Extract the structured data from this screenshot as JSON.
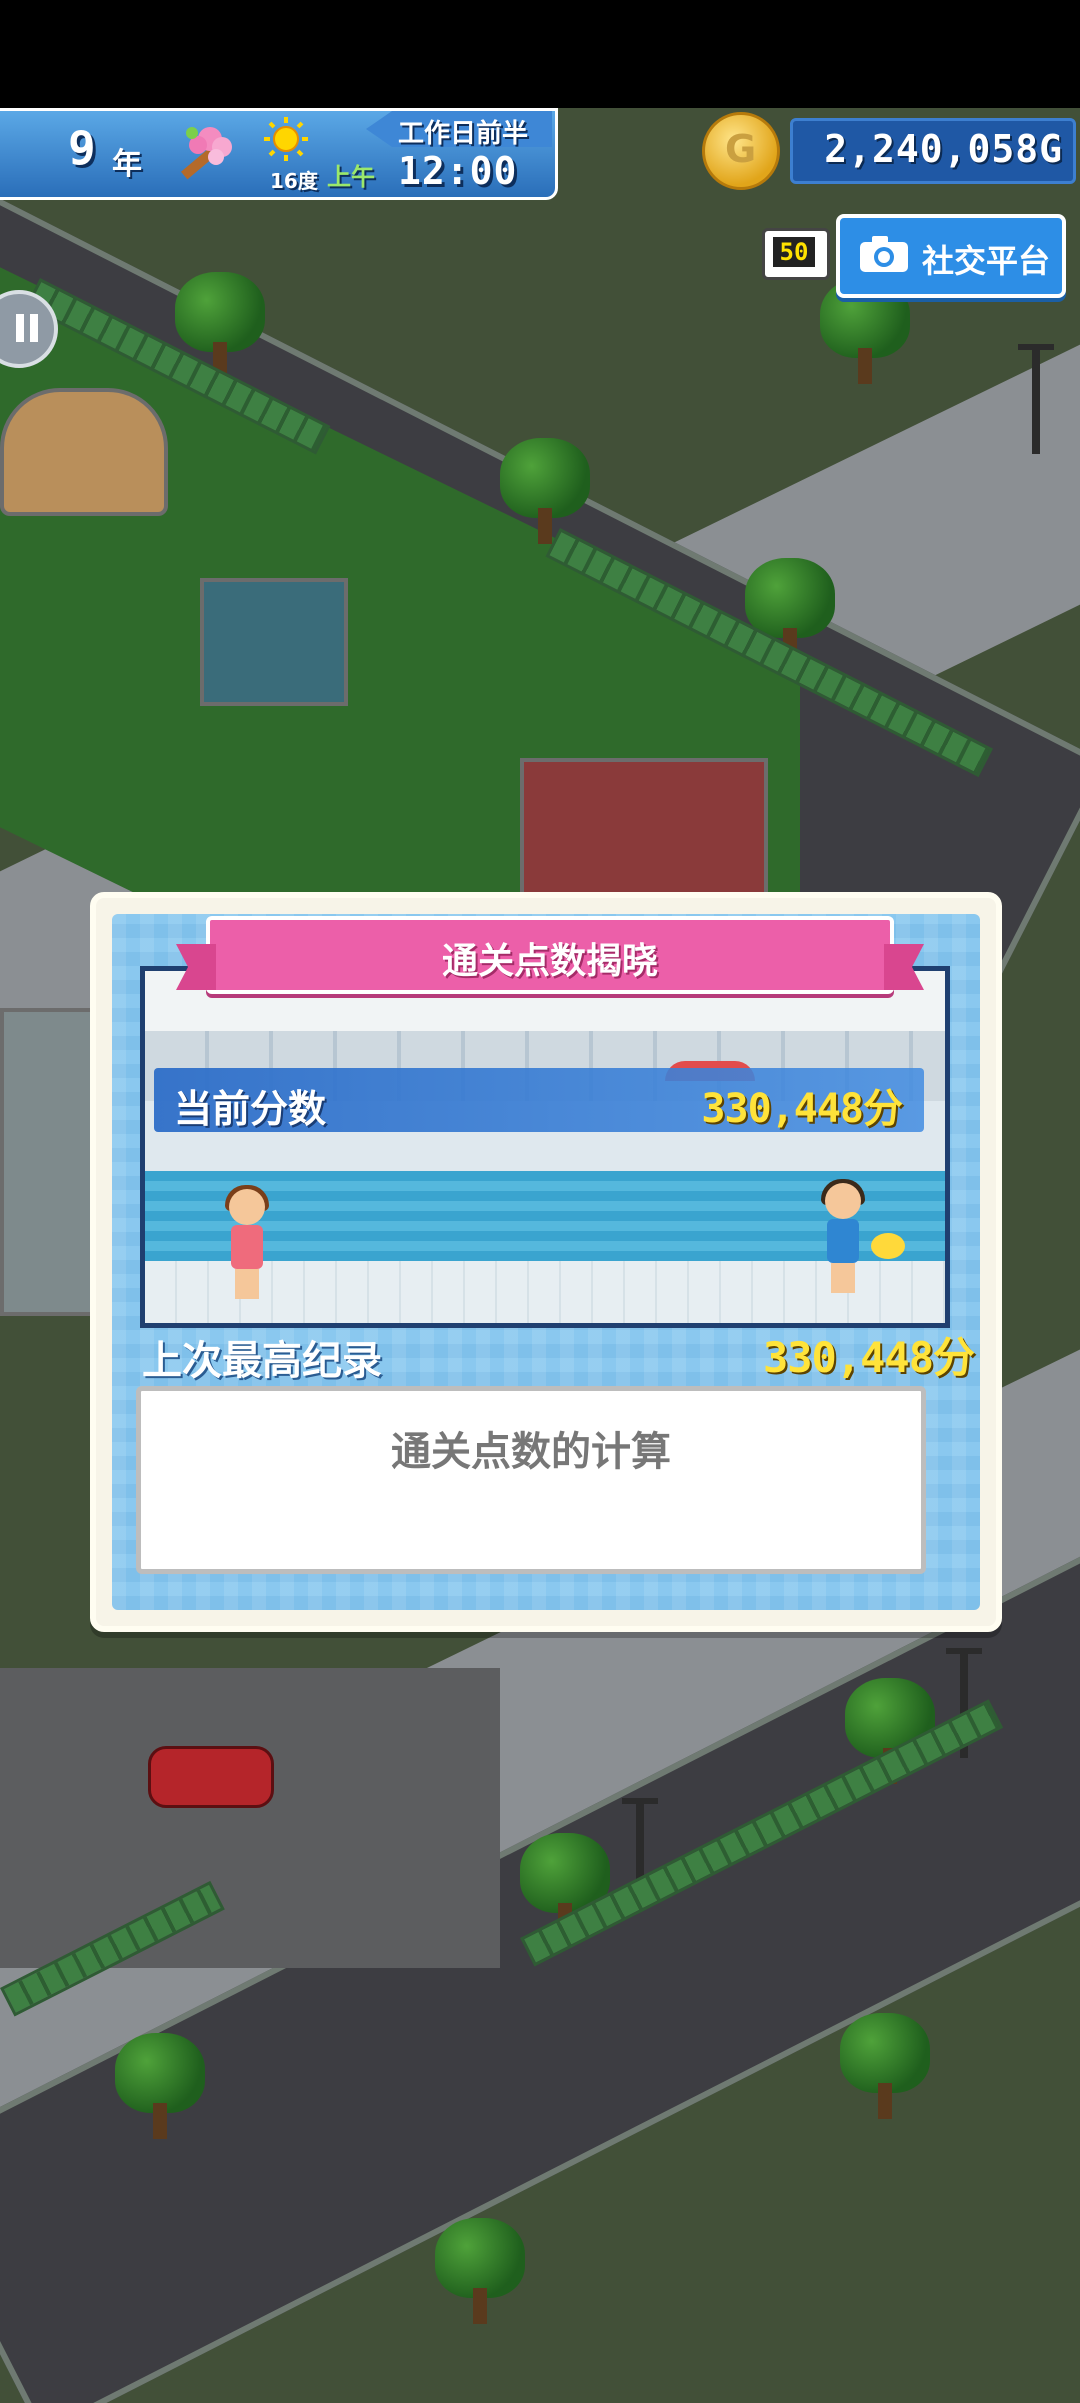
{
  "hud": {
    "year_number": "9",
    "year_unit": "年",
    "temperature": "16度",
    "period_tag": "工作日前半",
    "ampm": "上午",
    "time": "12:00",
    "money": "2,240,058G"
  },
  "sns": {
    "count": "50",
    "label": "社交平台"
  },
  "dialog": {
    "title": "通关点数揭晓",
    "current_score_label": "当前分数",
    "current_score_value": "330,448分",
    "best_record_label": "上次最高纪录",
    "best_record_value": "330,448分",
    "calc_label": "通关点数的计算"
  },
  "colors": {
    "hud_blue": "#2a6eb9",
    "banner_pink": "#ec5fa9",
    "score_yellow": "#ffe33a",
    "sns_blue": "#2d8ee6",
    "coin_gold": "#e1a51a"
  }
}
